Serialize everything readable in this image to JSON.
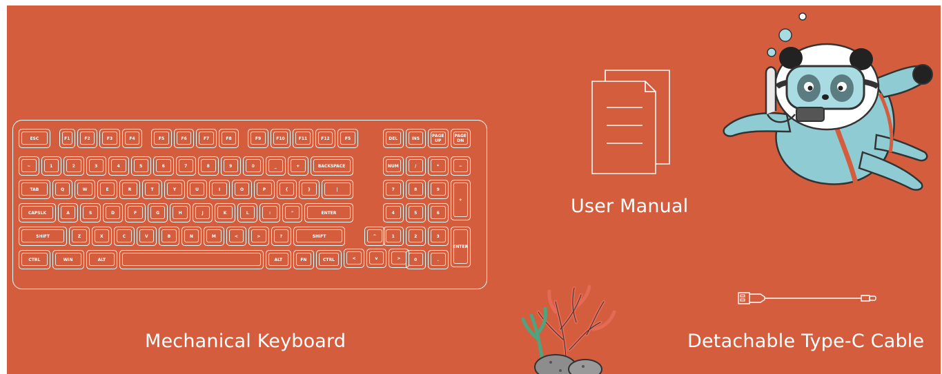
{
  "background_color": "#d45d3e",
  "line_color": "#ffffff",
  "captions": {
    "keyboard": "Mechanical Keyboard",
    "manual": "User Manual",
    "cable": "Detachable Type-C Cable"
  },
  "keyboard": {
    "rows": [
      [
        "ESC",
        "F1",
        "F2",
        "F3",
        "F4",
        "F5",
        "F6",
        "F7",
        "F8",
        "F9",
        "F10",
        "F11",
        "F12",
        "F5",
        "DEL",
        "INS",
        "PAGE UP",
        "PAGE DN"
      ],
      [
        "~",
        "1",
        "2",
        "3",
        "4",
        "5",
        "6",
        "7",
        "8",
        "9",
        "0",
        "_",
        "+",
        "BACKSPACE",
        "NUM",
        "/",
        "*",
        "−"
      ],
      [
        "TAB",
        "Q",
        "W",
        "E",
        "R",
        "T",
        "Y",
        "U",
        "I",
        "O",
        "P",
        "{",
        "}",
        "|",
        "7",
        "8",
        "9",
        "+"
      ],
      [
        "CAPSLK",
        "A",
        "S",
        "D",
        "F",
        "G",
        "H",
        "J",
        "K",
        "L",
        ":",
        "\"",
        "ENTER",
        "4",
        "5",
        "6"
      ],
      [
        "SHIFT",
        "Z",
        "X",
        "C",
        "V",
        "B",
        "N",
        "M",
        "<",
        ">",
        "?",
        "SHIFT",
        "^",
        "1",
        "2",
        "3",
        "ENTER"
      ],
      [
        "CTRL",
        "WIN",
        "ALT",
        "",
        "ALT",
        "FN",
        "CTRL",
        "<",
        "v",
        ">",
        "0",
        "."
      ]
    ]
  },
  "icons": {
    "manual": "document-icon",
    "cable": "usb-cable-icon",
    "mascot": "panda-diver-icon",
    "coral": "coral-icon"
  }
}
